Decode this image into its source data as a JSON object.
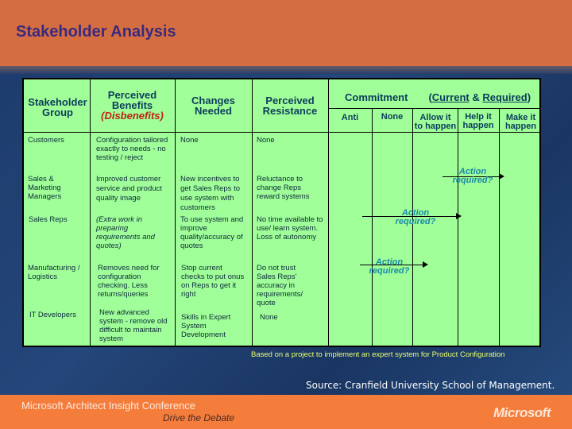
{
  "slide": {
    "title": "Stakeholder Analysis"
  },
  "table": {
    "headers": {
      "group": [
        "Stakeholder",
        "Group"
      ],
      "benefits": [
        "Perceived",
        "Benefits"
      ],
      "disbenefits": "(Disbenefits)",
      "changes": [
        "Changes",
        "Needed"
      ],
      "resistance": [
        "Perceived",
        "Resistance"
      ],
      "commitment": "Commitment",
      "commitment_open": "(",
      "current": "Current",
      "amp": " & ",
      "required": "Required",
      "commitment_close": ")",
      "levels": [
        {
          "l1": "Anti",
          "l2": ""
        },
        {
          "l1": "None",
          "l2": ""
        },
        {
          "l1": "Allow it",
          "l2": "to happen"
        },
        {
          "l1": "Help it",
          "l2": "happen"
        },
        {
          "l1": "Make it",
          "l2": "happen"
        }
      ]
    },
    "rows": [
      {
        "group": "Customers",
        "benefits": "Configuration tailored exactly to needs - no testing / reject",
        "changes": "None",
        "resistance": "None"
      },
      {
        "group": "Sales & Marketing Managers",
        "benefits": "Improved customer service and product quality image",
        "changes": "New incentives to get Sales Reps to use system with customers",
        "resistance": "Reluctance to change Reps reward systems"
      },
      {
        "group": "Sales Reps",
        "benefits": "(Extra work in preparing requirements and quotes)",
        "changes": "To use system and improve quality/accuracy of quotes",
        "resistance": "No time available to use/ learn system. Loss of autonomy"
      },
      {
        "group": "Manufacturing / Logistics",
        "benefits": "Removes need for configuration checking. Less returns/queries",
        "changes": "Stop current checks to put onus on Reps to get it right",
        "resistance": "Do not trust Sales Reps' accuracy in requirements/ quote"
      },
      {
        "group": "IT Developers",
        "benefits": "New advanced system - remove old difficult to maintain system",
        "changes": "Skills in Expert System Development",
        "resistance": "None"
      }
    ],
    "actions": [
      {
        "row": "Sales & Marketing Managers",
        "from": "Allow it to happen",
        "to": "Make it happen",
        "l1": "Action",
        "l2": "required?"
      },
      {
        "row": "Sales Reps",
        "from": "None",
        "to": "Help it happen",
        "l1": "Action",
        "l2": "required?"
      },
      {
        "row": "Manufacturing / Logistics",
        "from": "Anti",
        "to": "Allow it to happen",
        "l1": "Action",
        "l2": "required?"
      }
    ]
  },
  "footnote": "Based on a project to implement an expert system for Product Configuration",
  "source": "Source:  Cranfield University School of Management.",
  "footer": {
    "conference": "Microsoft Architect Insight Conference",
    "tagline": "Drive the Debate",
    "logo": "Microsoft"
  }
}
